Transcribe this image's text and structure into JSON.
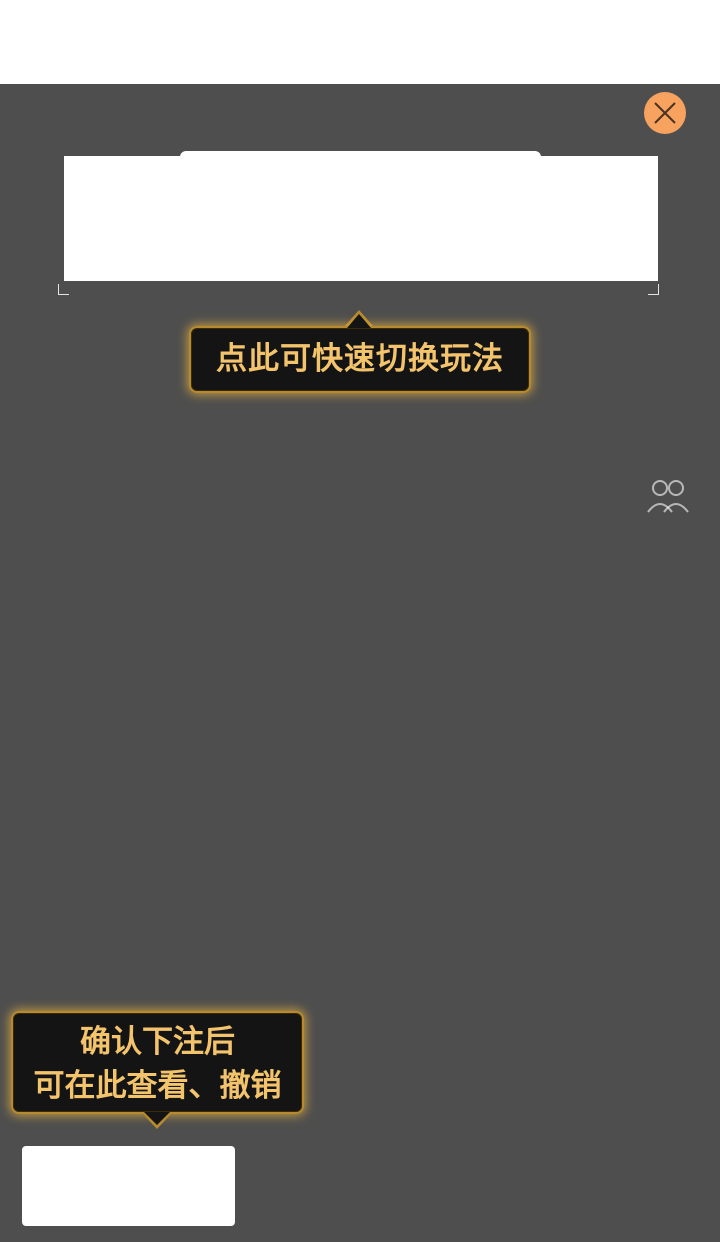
{
  "tooltips": {
    "switch_play": "点此可快速切换玩法",
    "bet_record_line1": "确认下注后",
    "bet_record_line2": "可在此查看、撤销"
  },
  "icons": {
    "close": "close-icon",
    "faint_side": "user-group-icon"
  },
  "colors": {
    "overlay": "#4e4e4e",
    "close_button": "#f7a25f",
    "tip_text": "#f3c46b",
    "tip_border": "#b88a2e"
  }
}
